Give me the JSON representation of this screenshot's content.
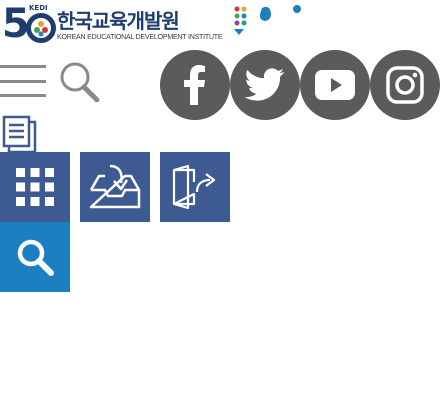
{
  "logo": {
    "number": "5",
    "tag": "KEDI",
    "title_kr": "한국교육개발원",
    "title_en": "KOREAN EDUCATIONAL DEVELOPMENT INSTITUTE"
  },
  "header": {
    "menu_icon": "hamburger-menu-icon",
    "search_icon": "search-icon"
  },
  "social": [
    {
      "name": "facebook",
      "icon": "facebook-icon"
    },
    {
      "name": "twitter",
      "icon": "twitter-icon"
    },
    {
      "name": "youtube",
      "icon": "youtube-icon"
    },
    {
      "name": "instagram",
      "icon": "instagram-icon"
    }
  ],
  "tiles": {
    "apps_icon": "grid-icon",
    "download_icon": "inbox-download-icon",
    "logout_icon": "door-exit-icon",
    "search_icon": "search-icon"
  },
  "colors": {
    "brand_navy": "#1f3d6e",
    "tile_blue": "#3d5a93",
    "search_blue": "#1c7fc0",
    "social_gray": "#5b5b5b",
    "icon_gray": "#8a8a8a"
  }
}
